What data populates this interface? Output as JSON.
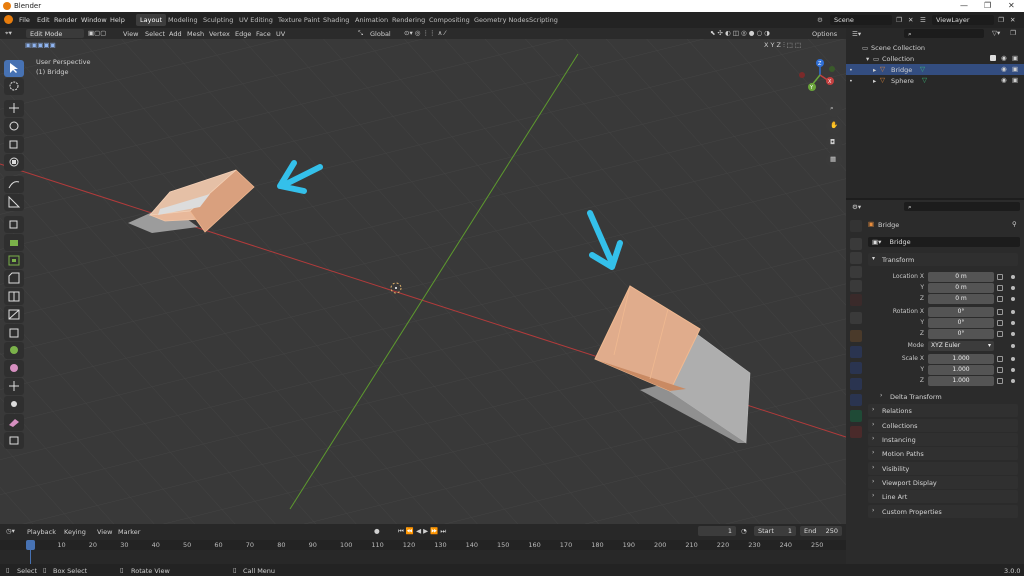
{
  "window": {
    "title": "Blender"
  },
  "menu": [
    "File",
    "Edit",
    "Render",
    "Window",
    "Help"
  ],
  "workspaces": [
    {
      "label": "Layout",
      "active": true
    },
    {
      "label": "Modeling"
    },
    {
      "label": "Sculpting"
    },
    {
      "label": "UV Editing"
    },
    {
      "label": "Texture Paint"
    },
    {
      "label": "Shading"
    },
    {
      "label": "Animation"
    },
    {
      "label": "Rendering"
    },
    {
      "label": "Compositing"
    },
    {
      "label": "Geometry Nodes"
    },
    {
      "label": "Scripting"
    }
  ],
  "scene": {
    "label": "Scene",
    "viewlayer": "ViewLayer"
  },
  "viewport": {
    "mode": "Edit Mode",
    "menus": [
      "View",
      "Select",
      "Add",
      "Mesh",
      "Vertex",
      "Edge",
      "Face",
      "UV"
    ],
    "orientation": "Global",
    "options": "Options",
    "overlay_title": "User Perspective",
    "overlay_object": "(1) Bridge",
    "gizmo": {
      "x": "X",
      "y": "Y",
      "z": "Z"
    },
    "accent_colors": {
      "mesh_selected": "#e8a27a",
      "arrow": "#34c0ea",
      "x_axis": "#c33f3f",
      "y_axis": "#6aa53a"
    }
  },
  "outliner": {
    "root": "Scene Collection",
    "collection": "Collection",
    "items": [
      {
        "label": "Bridge",
        "selected": true
      },
      {
        "label": "Sphere",
        "selected": false
      }
    ]
  },
  "properties": {
    "object_name": "Bridge",
    "data_name": "Bridge",
    "transform_label": "Transform",
    "location": {
      "label": "Location X",
      "x": "0 m",
      "y": "0 m",
      "z": "0 m"
    },
    "rotation": {
      "label": "Rotation X",
      "x": "0°",
      "y": "0°",
      "z": "0°"
    },
    "mode": {
      "label": "Mode",
      "value": "XYZ Euler"
    },
    "scale": {
      "label": "Scale X",
      "x": "1.000",
      "y": "1.000",
      "z": "1.000"
    },
    "axis_y": "Y",
    "axis_z": "Z",
    "panels": [
      "Delta Transform",
      "Relations",
      "Collections",
      "Instancing",
      "Motion Paths",
      "Visibility",
      "Viewport Display",
      "Line Art",
      "Custom Properties"
    ]
  },
  "timeline": {
    "menus": [
      "Playback",
      "Keying",
      "View",
      "Marker"
    ],
    "current_frame": "1",
    "start_label": "Start",
    "start": "1",
    "end_label": "End",
    "end": "250",
    "ruler": [
      "1",
      "10",
      "20",
      "30",
      "40",
      "50",
      "60",
      "70",
      "80",
      "90",
      "100",
      "110",
      "120",
      "130",
      "140",
      "150",
      "160",
      "170",
      "180",
      "190",
      "200",
      "210",
      "220",
      "230",
      "240",
      "250"
    ]
  },
  "status": {
    "select": "Select",
    "box_select": "Box Select",
    "rotate_view": "Rotate View",
    "call_menu": "Call Menu",
    "version": "3.0.0"
  }
}
